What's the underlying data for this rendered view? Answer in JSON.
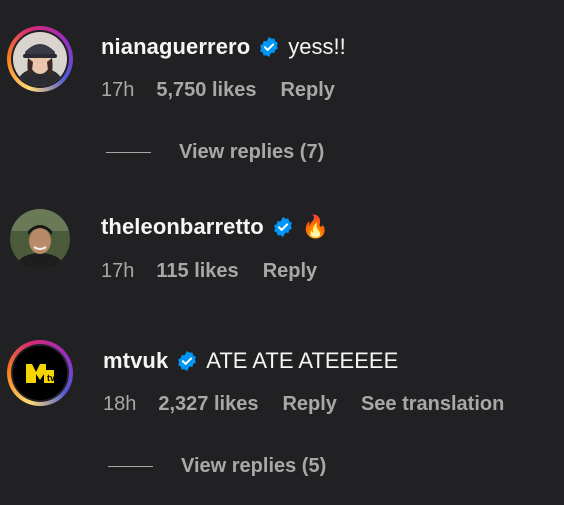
{
  "comments": [
    {
      "username": "nianaguerrero",
      "text": "yess!!",
      "time": "17h",
      "likes": "5,750 likes",
      "reply": "Reply",
      "view_replies": "View replies (7)"
    },
    {
      "username": "theleonbarretto",
      "text": "🔥",
      "time": "17h",
      "likes": "115 likes",
      "reply": "Reply"
    },
    {
      "username": "mtvuk",
      "text": "ATE ATE ATEEEEE",
      "time": "18h",
      "likes": "2,327 likes",
      "reply": "Reply",
      "see_translation": "See translation",
      "view_replies": "View replies (5)"
    }
  ],
  "colors": {
    "background": "#212124",
    "primary_text": "#f5f5f5",
    "secondary_text": "#a8a8a8",
    "verified_blue": "#0095f6"
  },
  "icons": [
    "verified-badge-icon",
    "fire-emoji-icon"
  ]
}
